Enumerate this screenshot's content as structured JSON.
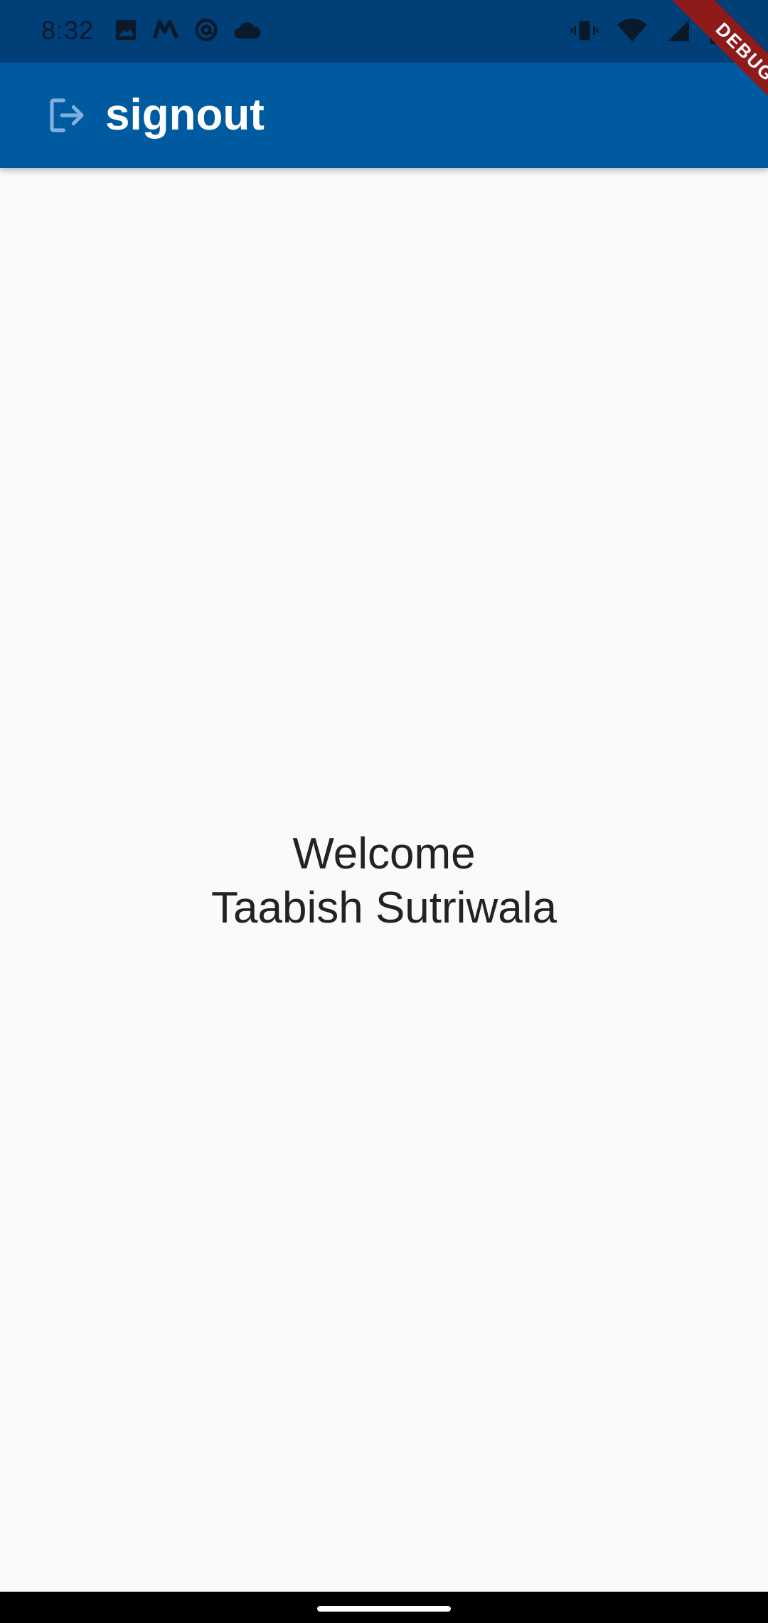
{
  "status_bar": {
    "time": "8:32",
    "left_icons": [
      "image-icon",
      "m-app-icon",
      "at-sign-icon",
      "cloud-icon"
    ],
    "right_icons": [
      "vibrate-icon",
      "wifi-icon",
      "signal-icon",
      "battery-icon"
    ]
  },
  "app_bar": {
    "icon": "signout-icon",
    "title": "signout",
    "color": "#005aa0"
  },
  "debug_banner": {
    "label": "DEBUG",
    "color": "#8e1a1a"
  },
  "main": {
    "welcome_line1": "Welcome",
    "welcome_line2": "Taabish Sutriwala"
  },
  "colors": {
    "status_bar": "#003f78",
    "background": "#fafafa",
    "text": "#222222"
  }
}
